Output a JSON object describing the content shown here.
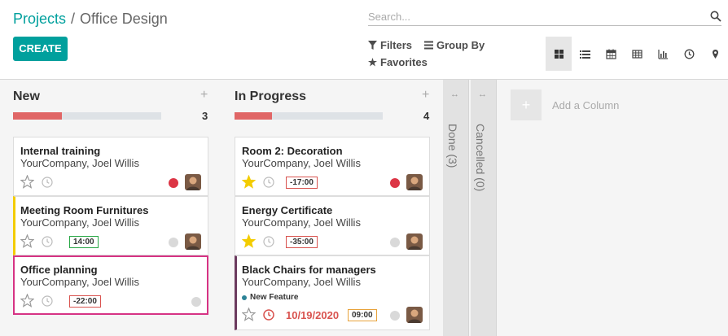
{
  "breadcrumb": {
    "root": "Projects",
    "sep": "/",
    "current": "Office Design"
  },
  "create_label": "CREATE",
  "search": {
    "placeholder": "Search..."
  },
  "filters": {
    "filters_label": "Filters",
    "group_by_label": "Group By",
    "favorites_label": "Favorites"
  },
  "views": [
    {
      "icon": "kanban-view-icon",
      "active": true
    },
    {
      "icon": "list-view-icon"
    },
    {
      "icon": "calendar-view-icon"
    },
    {
      "icon": "pivot-view-icon"
    },
    {
      "icon": "graph-view-icon"
    },
    {
      "icon": "activity-view-icon"
    },
    {
      "icon": "map-view-icon"
    }
  ],
  "columns": {
    "new": {
      "title": "New",
      "count": "3",
      "progress_red": 0.33,
      "cards": [
        {
          "title": "Internal training",
          "sub": "YourCompany, Joel Willis",
          "starred": false,
          "deadline": "",
          "state": "red"
        },
        {
          "title": "Meeting Room Furnitures",
          "sub": "YourCompany, Joel Willis",
          "starred": false,
          "deadline": "14:00",
          "deadline_color": "green",
          "state": "grey"
        },
        {
          "title": "Office planning",
          "sub": "YourCompany, Joel Willis",
          "starred": false,
          "deadline": "-22:00",
          "deadline_color": "red",
          "state": "grey"
        }
      ]
    },
    "in_progress": {
      "title": "In Progress",
      "count": "4",
      "progress_red": 0.25,
      "cards": [
        {
          "title": "Room 2: Decoration",
          "sub": "YourCompany, Joel Willis",
          "starred": true,
          "deadline": "-17:00",
          "deadline_color": "red",
          "state": "red"
        },
        {
          "title": "Energy Certificate",
          "sub": "YourCompany, Joel Willis",
          "starred": true,
          "deadline": "-35:00",
          "deadline_color": "red",
          "state": "grey"
        },
        {
          "title": "Black Chairs for managers",
          "sub": "YourCompany, Joel Willis",
          "tag": "New Feature",
          "overdue_date": "10/19/2020",
          "deadline": "09:00",
          "deadline_color": "orange",
          "state": "grey"
        }
      ]
    }
  },
  "folded": {
    "done": "Done (3)",
    "cancelled": "Cancelled (0)"
  },
  "add_column": {
    "plus": "+",
    "label": "Add a Column"
  },
  "colors": {
    "brand": "#00a09d",
    "danger": "#dc3545",
    "star": "#f3cc00",
    "highlight": "#d63384"
  }
}
